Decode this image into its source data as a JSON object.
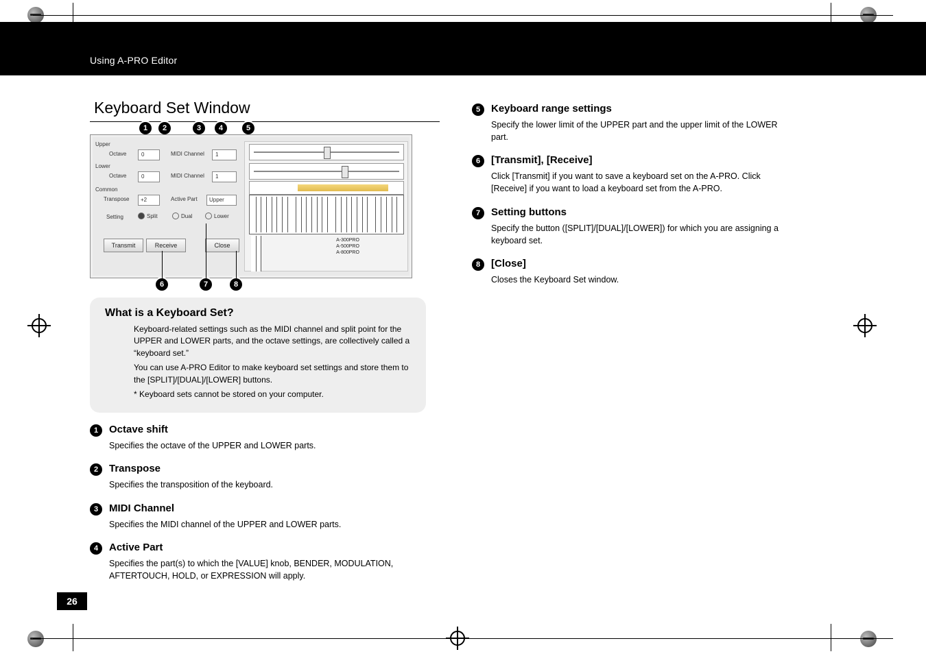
{
  "breadcrumb": "Using A-PRO Editor",
  "section_title": "Keyboard Set Window",
  "page_number": "26",
  "info": {
    "title": "What is a Keyboard Set?",
    "p1": "Keyboard-related settings such as the MIDI channel and split point for the UPPER and LOWER parts, and the octave settings, are collectively called a “keyboard set.”",
    "p2": "You can use A-PRO Editor to make keyboard set settings and store them to the [SPLIT]/[DUAL]/[LOWER] buttons.",
    "note": "Keyboard sets cannot be stored on your computer."
  },
  "items_left": [
    {
      "n": "1",
      "title": "Octave shift",
      "body": "Specifies the octave of the UPPER and LOWER parts."
    },
    {
      "n": "2",
      "title": "Transpose",
      "body": "Specifies the transposition of the keyboard."
    },
    {
      "n": "3",
      "title": "MIDI Channel",
      "body": "Specifies the MIDI channel of the UPPER and LOWER parts."
    },
    {
      "n": "4",
      "title": "Active Part",
      "body": "Specifies the part(s) to which the [VALUE] knob, BENDER, MODULATION, AFTERTOUCH, HOLD, or EXPRESSION will apply."
    }
  ],
  "items_right": [
    {
      "n": "5",
      "title": "Keyboard range settings",
      "body": "Specify the lower limit of the UPPER part and the upper limit of the LOWER part."
    },
    {
      "n": "6",
      "title": "[Transmit], [Receive]",
      "body": "Click [Transmit] if you want to save a keyboard set on the A-PRO. Click [Receive] if you want to load a keyboard set from the A-PRO."
    },
    {
      "n": "7",
      "title": "Setting buttons",
      "body": "Specify the button ([SPLIT]/[DUAL]/[LOWER]) for which you are assigning a keyboard set."
    },
    {
      "n": "8",
      "title": "[Close]",
      "body": "Closes the Keyboard Set window."
    }
  ],
  "shot": {
    "groups": {
      "upper": "Upper",
      "lower": "Lower",
      "common": "Common"
    },
    "labels": {
      "octave": "Octave",
      "midi": "MIDI Channel",
      "transpose": "Transpose",
      "active": "Active Part",
      "setting": "Setting"
    },
    "values": {
      "octave_upper": "0",
      "octave_lower": "0",
      "midi_upper": "1",
      "midi_lower": "1",
      "transpose": "+2",
      "active": "Upper"
    },
    "radios": {
      "split": "Split",
      "dual": "Dual",
      "lower": "Lower"
    },
    "buttons": {
      "transmit": "Transmit",
      "receive": "Receive",
      "close": "Close"
    },
    "models": {
      "a": "A-300PRO",
      "b": "A-500PRO",
      "c": "A-800PRO"
    },
    "callouts_top": [
      "1",
      "2",
      "3",
      "4",
      "5"
    ],
    "callouts_bottom": [
      "6",
      "7",
      "8"
    ]
  }
}
